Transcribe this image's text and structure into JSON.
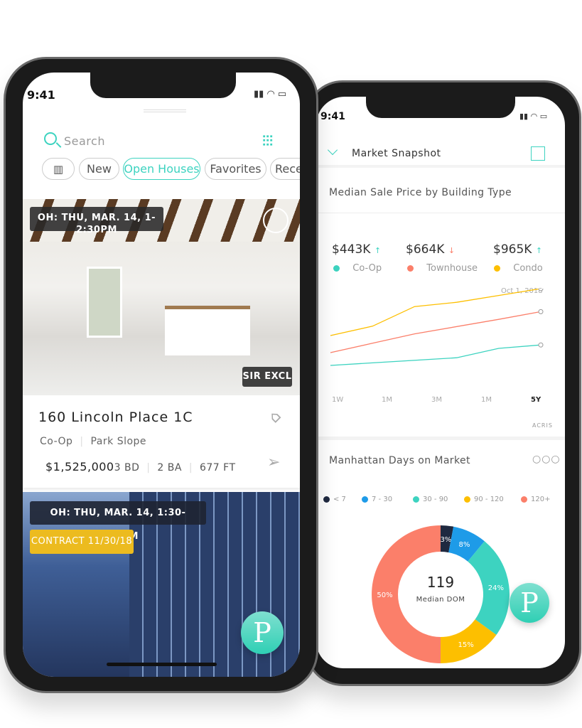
{
  "left_phone": {
    "status": {
      "time": "9:41"
    },
    "search": {
      "placeholder": "Search"
    },
    "filters": [
      {
        "label": "New"
      },
      {
        "label": "Open Houses",
        "active": true
      },
      {
        "label": "Favorites"
      },
      {
        "label": "Recen"
      }
    ],
    "listings": [
      {
        "open_house": "OH: THU, MAR. 14, 1-2:30PM",
        "badge": "SIR EXCL",
        "title": "160 Lincoln Place 1C",
        "type": "Co-Op",
        "neighborhood": "Park Slope",
        "price": "$1,525,000",
        "beds": "3 BD",
        "baths": "2 BA",
        "size": "677 FT"
      },
      {
        "open_house": "OH: THU, MAR. 14, 1:30-2:30PM",
        "contract": "CONTRACT 11/30/18"
      }
    ],
    "fab": "P"
  },
  "right_phone": {
    "status": {
      "time": "9:41"
    },
    "header": {
      "title": "Market Snapshot"
    },
    "price_card": {
      "title": "Median Sale Price by Building Type",
      "stats": [
        {
          "value": "$443K",
          "trend": "↑",
          "label": "Co-Op",
          "color": "#3dd3c0"
        },
        {
          "value": "$664K",
          "trend": "↓",
          "label": "Townhouse",
          "color": "#fb7f6a"
        },
        {
          "value": "$965K",
          "trend": "↑",
          "label": "Condo",
          "color": "#fdbf00"
        }
      ],
      "date": "Oct 1, 2018",
      "source": "ACRIS"
    },
    "dom_card": {
      "title": "Manhattan Days on Market",
      "center_value": "119",
      "center_label": "Median DOM"
    },
    "fab": "P"
  },
  "chart_data": [
    {
      "type": "line",
      "x_ticks": [
        "1W",
        "1M",
        "3M",
        "1M",
        "5Y"
      ],
      "selected_tick": "5Y",
      "series": [
        {
          "name": "Condo",
          "color": "#fdbf00",
          "values": [
            [
              0,
              45
            ],
            [
              1,
              56
            ],
            [
              2,
              79
            ],
            [
              3,
              84
            ],
            [
              4,
              92
            ],
            [
              5,
              100
            ]
          ]
        },
        {
          "name": "Townhouse",
          "color": "#fb7f6a",
          "values": [
            [
              0,
              25
            ],
            [
              1,
              36
            ],
            [
              2,
              47
            ],
            [
              4,
              64
            ],
            [
              5,
              73
            ]
          ]
        },
        {
          "name": "Co-Op",
          "color": "#3dd3c0",
          "values": [
            [
              0,
              10
            ],
            [
              1,
              13
            ],
            [
              3,
              19
            ],
            [
              4,
              30
            ],
            [
              5,
              34
            ]
          ]
        }
      ]
    },
    {
      "type": "pie",
      "donut": true,
      "categories": [
        "< 7",
        "7 - 30",
        "30 - 90",
        "90 - 120",
        "120+"
      ],
      "values": [
        3,
        8,
        24,
        15,
        50
      ],
      "labels": [
        "3%",
        "8%",
        "24%",
        "15%",
        "50%"
      ],
      "colors": [
        "#1f2940",
        "#1e9be8",
        "#3dd3c0",
        "#fdbf00",
        "#fb7f6a"
      ]
    }
  ]
}
